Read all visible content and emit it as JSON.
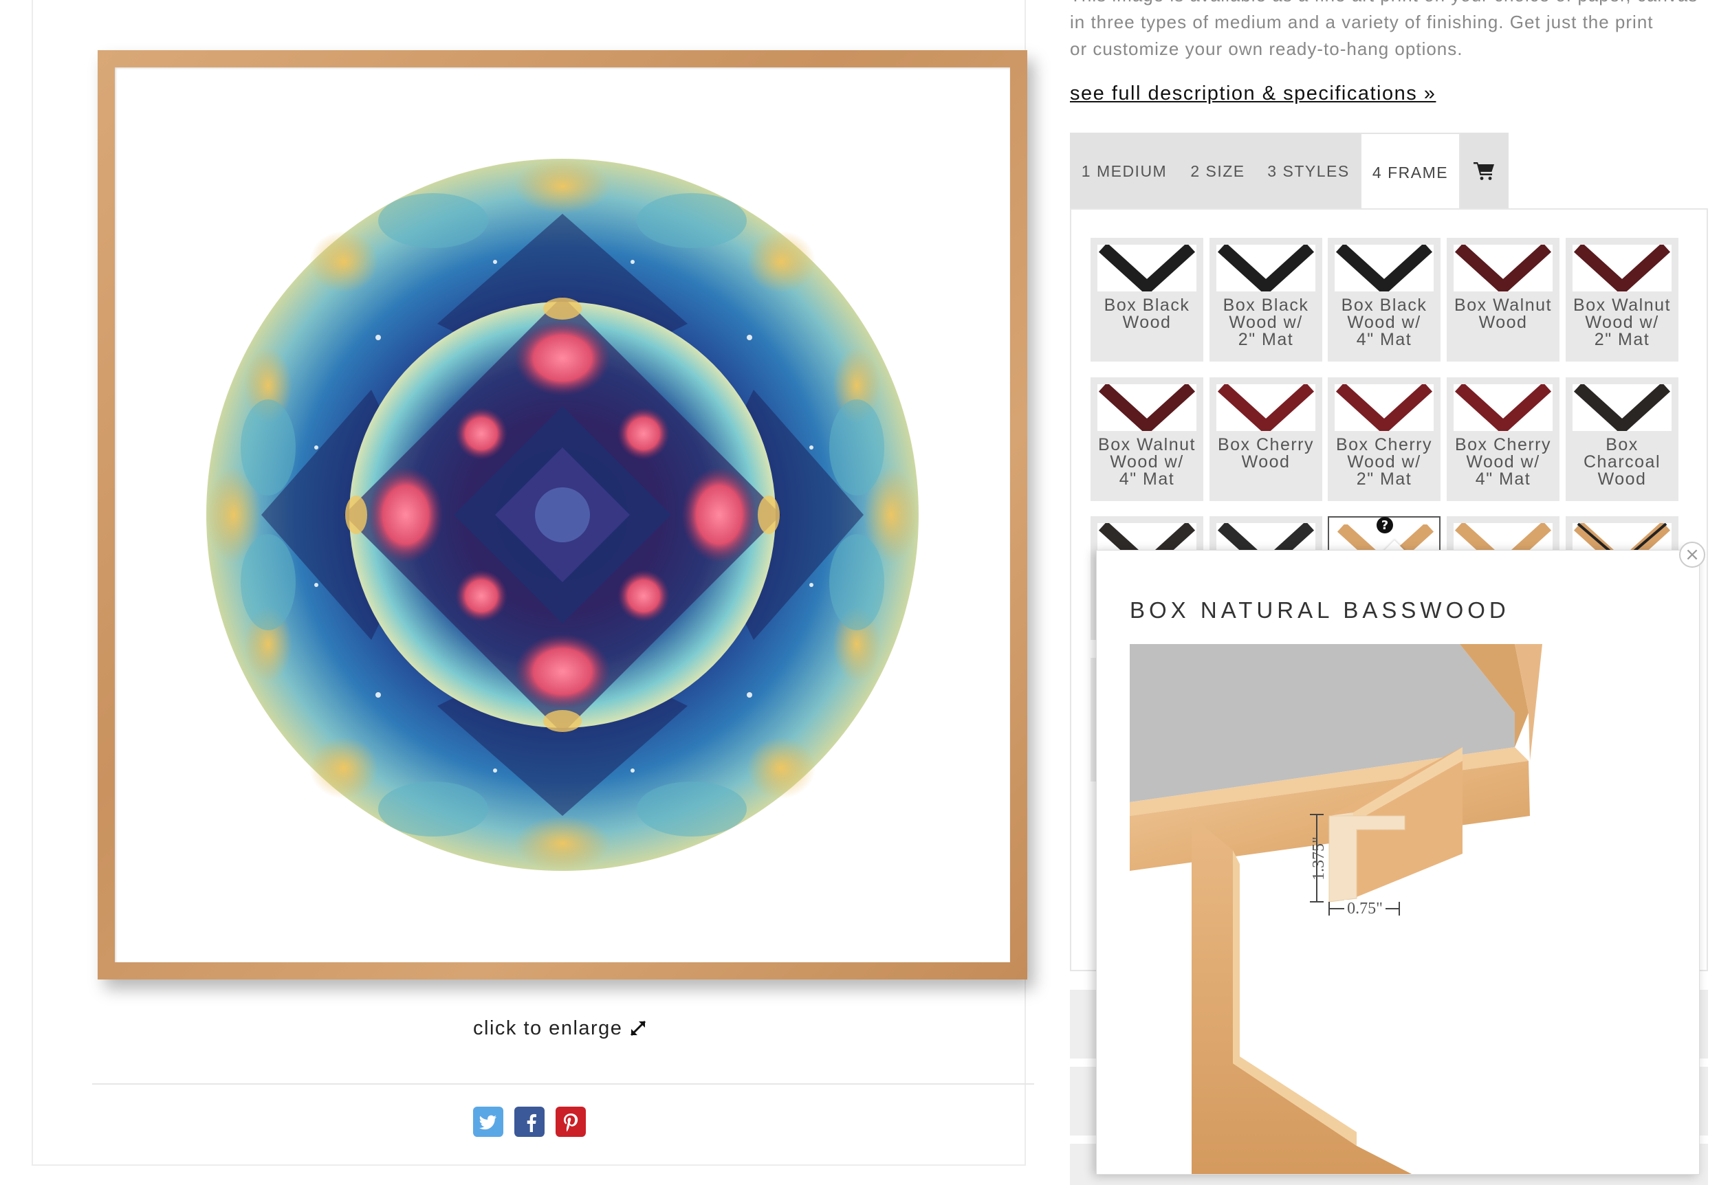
{
  "description": {
    "line1": "This image is available as a fine art print on your choice of paper, canvas",
    "line2": "in three types of medium and a variety of finishing. Get just the print",
    "line3": "or customize your own ready-to-hang options.",
    "full_link": "see full description & specifications »"
  },
  "artwork": {
    "enlarge_label": "click to enlarge"
  },
  "social": [
    "twitter-icon",
    "facebook-icon",
    "pinterest-icon"
  ],
  "tabs": [
    {
      "label": "1 MEDIUM",
      "active": false
    },
    {
      "label": "2 SIZE",
      "active": false
    },
    {
      "label": "3 STYLES",
      "active": false
    },
    {
      "label": "4 FRAME",
      "active": true
    },
    {
      "label": "",
      "icon": "cart-icon",
      "active": false
    }
  ],
  "frames": [
    {
      "l1": "Box Black",
      "l2": "Wood",
      "l3": "",
      "color": "#1e1e1e"
    },
    {
      "l1": "Box Black",
      "l2": "Wood w/",
      "l3": "2\" Mat",
      "color": "#1e1e1e"
    },
    {
      "l1": "Box Black",
      "l2": "Wood w/",
      "l3": "4\" Mat",
      "color": "#1e1e1e"
    },
    {
      "l1": "Box Walnut",
      "l2": "Wood",
      "l3": "",
      "color": "#5a1a1e"
    },
    {
      "l1": "Box Walnut",
      "l2": "Wood w/",
      "l3": "2\" Mat",
      "color": "#5a1a1e"
    },
    {
      "l1": "Box Walnut",
      "l2": "Wood w/",
      "l3": "4\" Mat",
      "color": "#5a1a1e"
    },
    {
      "l1": "Box Cherry",
      "l2": "Wood",
      "l3": "",
      "color": "#7a1e24"
    },
    {
      "l1": "Box Cherry",
      "l2": "Wood w/",
      "l3": "2\" Mat",
      "color": "#7a1e24"
    },
    {
      "l1": "Box Cherry",
      "l2": "Wood w/",
      "l3": "4\" Mat",
      "color": "#7a1e24"
    },
    {
      "l1": "Box",
      "l2": "Charcoal",
      "l3": "Wood",
      "color": "#2a2624"
    }
  ],
  "popup": {
    "title": "BOX NATURAL BASSWOOD",
    "height_dim": "1.375\"",
    "width_dim": "0.75\"",
    "close_label": "×"
  },
  "colors": {
    "frame_wood": "#c9925f",
    "basswood": "#e2b27a",
    "tab_bg": "#e2e2e2",
    "twitter": "#5aa7e6",
    "facebook": "#3b5998",
    "pinterest": "#cb2027"
  }
}
